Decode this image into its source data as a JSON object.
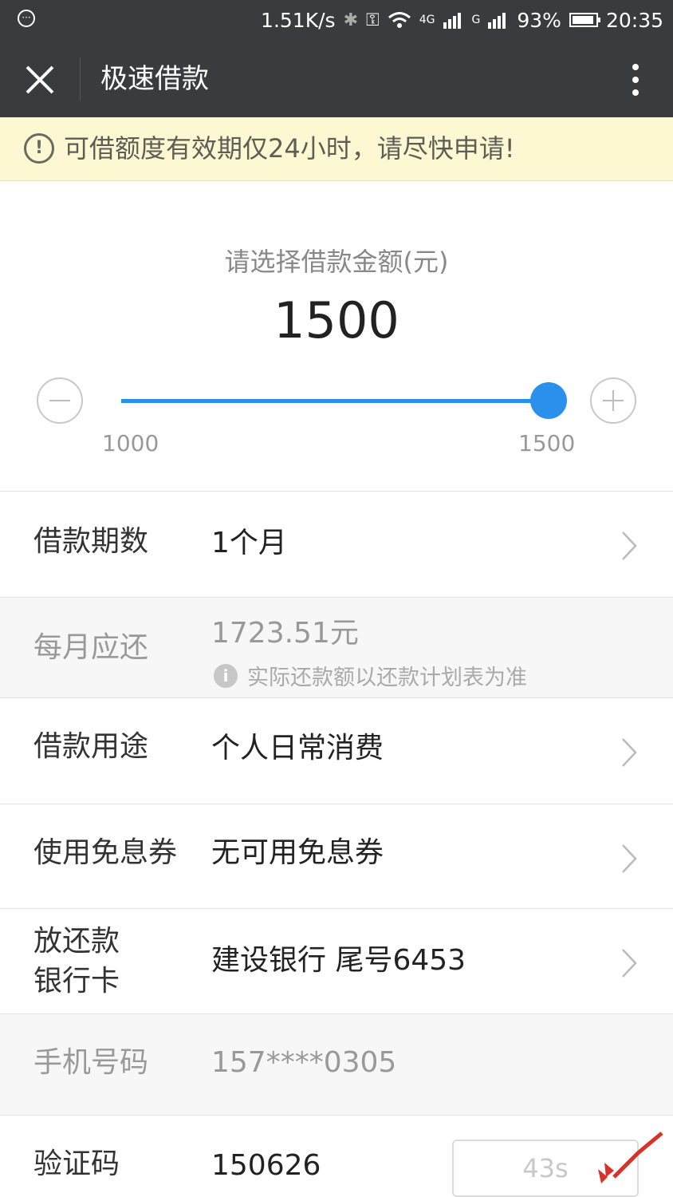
{
  "status_bar": {
    "speed": "1.51K/s",
    "net1": "4G",
    "net2": "G",
    "battery": "93%",
    "time": "20:35"
  },
  "navbar": {
    "title": "极速借款"
  },
  "notice": {
    "text": "可借额度有效期仅24小时，请尽快申请!"
  },
  "amount": {
    "label": "请选择借款金额(元)",
    "value": "1500",
    "min": "1000",
    "max": "1500",
    "slider_fraction": 1.0
  },
  "rows": {
    "term": {
      "label": "借款期数",
      "value": "1个月"
    },
    "monthly": {
      "label": "每月应还",
      "value": "1723.51元",
      "note": "实际还款额以还款计划表为准"
    },
    "purpose": {
      "label": "借款用途",
      "value": "个人日常消费"
    },
    "coupon": {
      "label": "使用免息券",
      "value": "无可用免息券"
    },
    "bank": {
      "label_line1": "放还款",
      "label_line2": "银行卡",
      "value": "建设银行 尾号6453"
    },
    "phone": {
      "label": "手机号码",
      "value": "157****0305"
    },
    "code": {
      "label": "验证码",
      "value": "150626",
      "countdown": "43s"
    }
  },
  "colors": {
    "accent": "#2b8fec",
    "header": "#3a3b3e",
    "notice_bg": "#fbf8d2"
  },
  "icons": [
    "close-icon",
    "more-icon",
    "warning-icon",
    "minus-icon",
    "plus-icon",
    "chevron-right-icon",
    "info-icon"
  ]
}
